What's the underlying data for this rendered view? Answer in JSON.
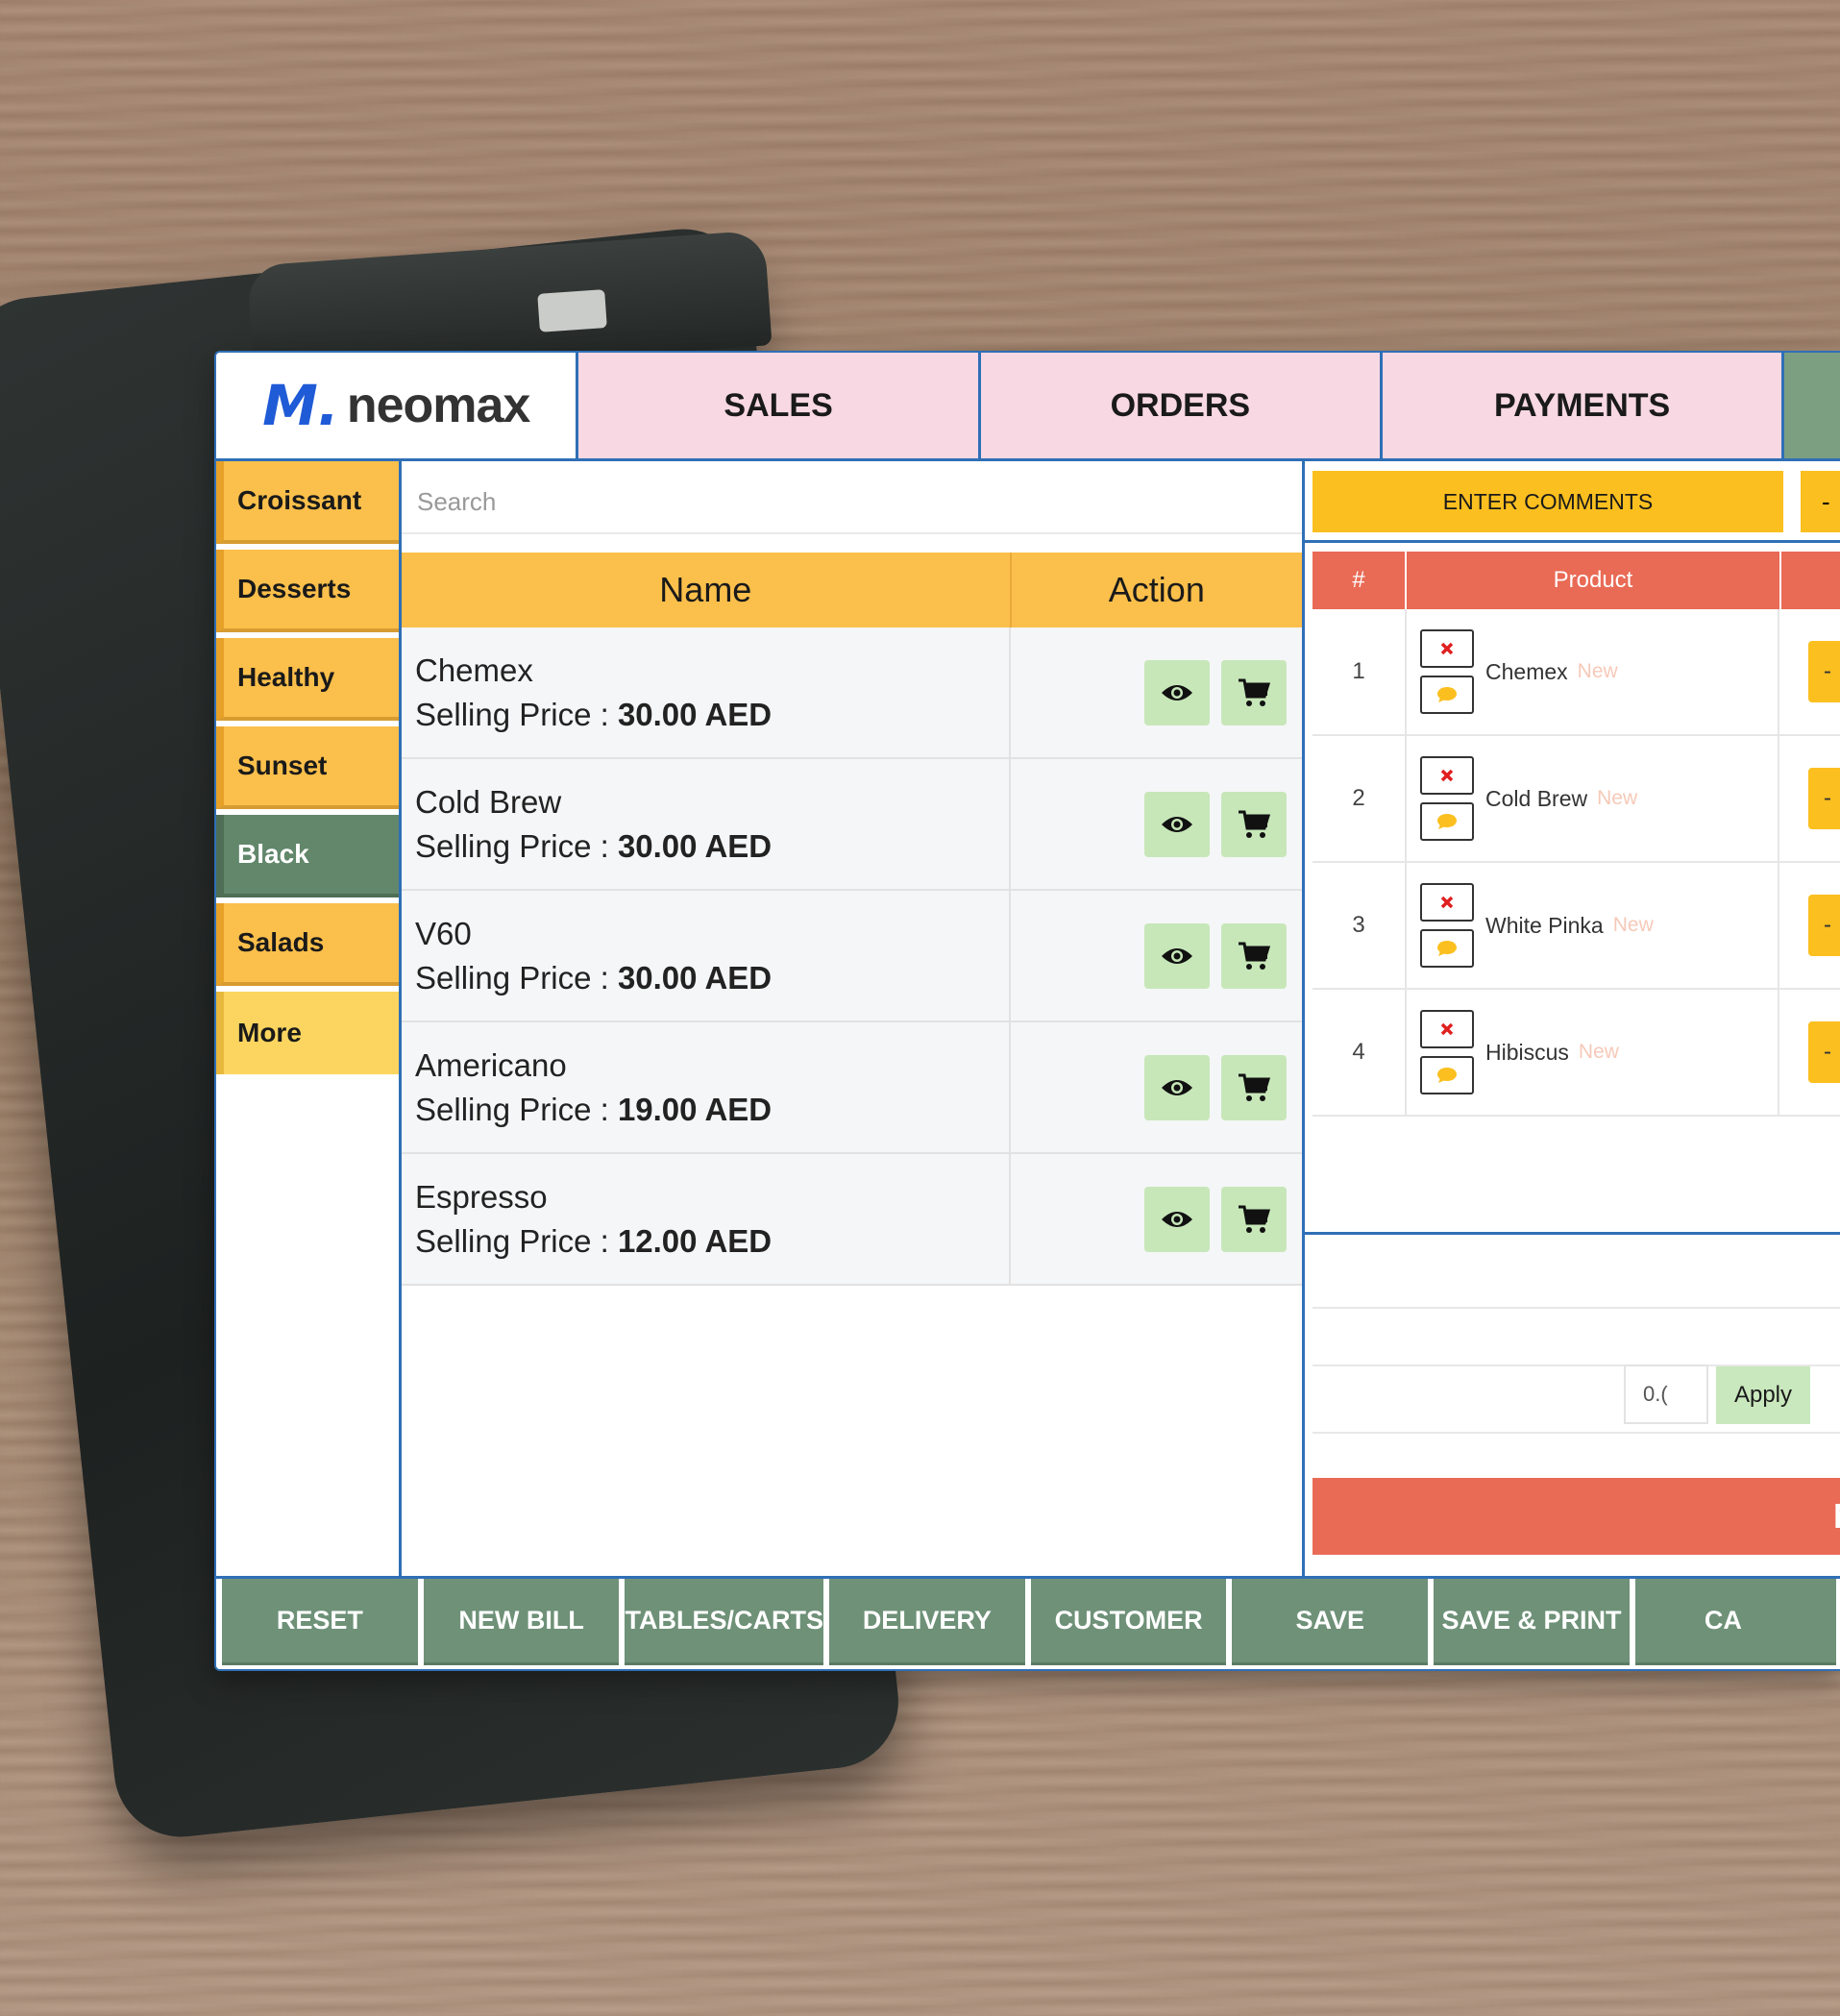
{
  "brand": {
    "logo_mark": "M.",
    "name": "neomax"
  },
  "nav": {
    "tabs": [
      "SALES",
      "ORDERS",
      "PAYMENTS"
    ]
  },
  "sidebar": {
    "categories": [
      "Croissant",
      "Desserts",
      "Healthy",
      "Sunset",
      "Black",
      "Salads",
      "More"
    ],
    "active": "Black"
  },
  "search": {
    "placeholder": "Search"
  },
  "product_table": {
    "headers": {
      "name": "Name",
      "action": "Action"
    },
    "price_label": "Selling Price : ",
    "rows": [
      {
        "name": "Chemex",
        "price": "30.00 AED"
      },
      {
        "name": "Cold Brew",
        "price": "30.00 AED"
      },
      {
        "name": "V60",
        "price": "30.00 AED"
      },
      {
        "name": "Americano",
        "price": "19.00 AED"
      },
      {
        "name": "Espresso",
        "price": "12.00 AED"
      }
    ]
  },
  "order_panel": {
    "comments_label": "ENTER COMMENTS",
    "qty_minus": "-",
    "headers": {
      "num": "#",
      "product": "Product"
    },
    "new_tag": "New",
    "rows": [
      {
        "num": "1",
        "product": "Chemex"
      },
      {
        "num": "2",
        "product": "Cold Brew"
      },
      {
        "num": "3",
        "product": "White Pinka"
      },
      {
        "num": "4",
        "product": "Hibiscus"
      }
    ],
    "discount_value": "0.(",
    "apply_label": "Apply",
    "pay_label": "N"
  },
  "bottom_bar": {
    "buttons": [
      "RESET",
      "NEW BILL",
      "TABLES/CARTS",
      "DELIVERY",
      "CUSTOMER",
      "SAVE",
      "SAVE & PRINT",
      "CA"
    ]
  },
  "colors": {
    "accent_blue": "#2f6fb6",
    "category": "#fbbf4b",
    "category_active": "#62876b",
    "tab_pink": "#f7d8e3",
    "order_header": "#e96a55",
    "action_button": "#c7e7b9",
    "bottom_button": "#6e9178"
  }
}
